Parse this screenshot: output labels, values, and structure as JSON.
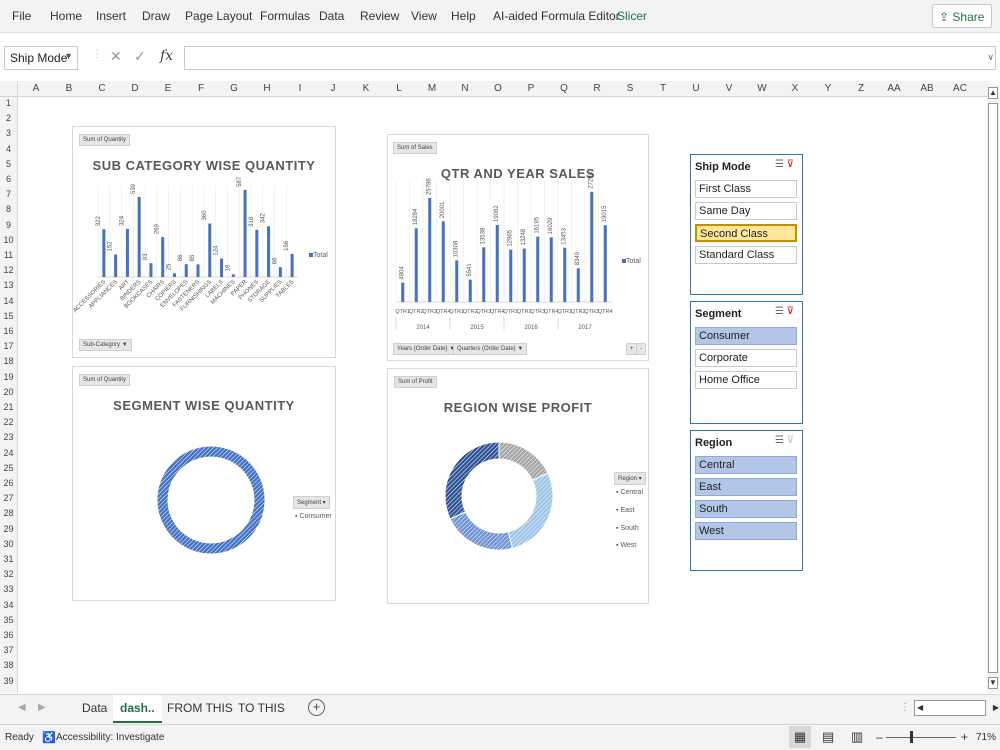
{
  "menu": [
    "File",
    "Home",
    "Insert",
    "Draw",
    "Page Layout",
    "Formulas",
    "Data",
    "Review",
    "View",
    "Help",
    "AI-aided Formula Editor",
    "Slicer"
  ],
  "share_label": "Share",
  "name_box": "Ship Mode",
  "formula_value": "",
  "columns": [
    "A",
    "B",
    "C",
    "D",
    "E",
    "F",
    "G",
    "H",
    "I",
    "J",
    "K",
    "L",
    "M",
    "N",
    "O",
    "P",
    "Q",
    "R",
    "S",
    "T",
    "U",
    "V",
    "W",
    "X",
    "Y",
    "Z",
    "AA",
    "AB",
    "AC"
  ],
  "rows": [
    "1",
    "2",
    "3",
    "4",
    "5",
    "6",
    "7",
    "8",
    "9",
    "10",
    "11",
    "12",
    "13",
    "14",
    "15",
    "16",
    "17",
    "18",
    "19",
    "20",
    "21",
    "22",
    "23",
    "24",
    "25",
    "26",
    "27",
    "28",
    "29",
    "30",
    "31",
    "32",
    "33",
    "34",
    "35",
    "36",
    "37",
    "38",
    "39"
  ],
  "charts": {
    "subcat": {
      "field_btn": "Sum of Quantity",
      "title": "SUB CATEGORY WISE QUANTITY",
      "legend": "Total",
      "filter_btn": "Sub-Category"
    },
    "qtr": {
      "field_btn": "Sum of Sales",
      "title": "QTR AND YEAR SALES",
      "legend": "Total",
      "filter_btn1": "Years (Order Date)",
      "filter_btn2": "Quarters (Order Date)",
      "years": [
        "2014",
        "2015",
        "2016",
        "2017"
      ]
    },
    "segment": {
      "field_btn": "Sum of Quantity",
      "title": "SEGMENT WISE QUANTITY",
      "legend_btn": "Segment",
      "legend_item": "Consumer"
    },
    "region": {
      "field_btn": "Sum of Profit",
      "title": "REGION WISE PROFIT",
      "legend_btn": "Region",
      "legend_items": [
        "Central",
        "East",
        "South",
        "West"
      ]
    }
  },
  "chart_data": [
    {
      "type": "bar",
      "title": "SUB CATEGORY WISE QUANTITY",
      "categories": [
        "ACCESSORIES",
        "APPLIANCES",
        "ART",
        "BINDERS",
        "BOOKCASES",
        "CHAIRS",
        "COPIERS",
        "ENVELOPES",
        "FASTENERS",
        "FURNISHINGS",
        "LABELS",
        "MACHINES",
        "PAPER",
        "PHONES",
        "STORAGE",
        "SUPPLIES",
        "TABLES"
      ],
      "values": [
        322,
        152,
        324,
        539,
        93,
        269,
        25,
        86,
        85,
        360,
        124,
        18,
        587,
        318,
        342,
        66,
        156
      ],
      "series": [
        {
          "name": "Total"
        }
      ],
      "ylim": [
        0,
        620
      ]
    },
    {
      "type": "bar",
      "title": "QTR AND YEAR SALES",
      "categories": [
        "QTR1",
        "QTR2",
        "QTR3",
        "QTR4",
        "QTR1",
        "QTR2",
        "QTR3",
        "QTR4",
        "QTR1",
        "QTR2",
        "QTR3",
        "QTR4",
        "QTR1",
        "QTR2",
        "QTR3",
        "QTR4"
      ],
      "values": [
        4804,
        18284,
        25786,
        20001,
        10308,
        5541,
        13538,
        19082,
        12965,
        13248,
        16195,
        16029,
        13453,
        8349,
        27298,
        19015
      ],
      "series": [
        {
          "name": "Total"
        }
      ],
      "ylim": [
        0,
        28500
      ]
    },
    {
      "type": "pie",
      "title": "SEGMENT WISE QUANTITY",
      "categories": [
        "Consumer"
      ],
      "values": [
        100
      ]
    },
    {
      "type": "pie",
      "title": "REGION WISE PROFIT",
      "categories": [
        "Central",
        "East",
        "South",
        "West"
      ],
      "values": [
        18,
        28,
        22,
        32
      ]
    }
  ],
  "slicers": {
    "ship_mode": {
      "title": "Ship Mode",
      "items": [
        "First Class",
        "Same Day",
        "Second Class",
        "Standard Class"
      ]
    },
    "segment": {
      "title": "Segment",
      "items": [
        "Consumer",
        "Corporate",
        "Home Office"
      ]
    },
    "region": {
      "title": "Region",
      "items": [
        "Central",
        "East",
        "South",
        "West"
      ]
    }
  },
  "sheet_tabs": [
    "Data",
    "dash..",
    "FROM THIS",
    "TO THIS"
  ],
  "status": {
    "ready": "Ready",
    "accessibility": "Accessibility: Investigate",
    "zoom": "71%"
  }
}
